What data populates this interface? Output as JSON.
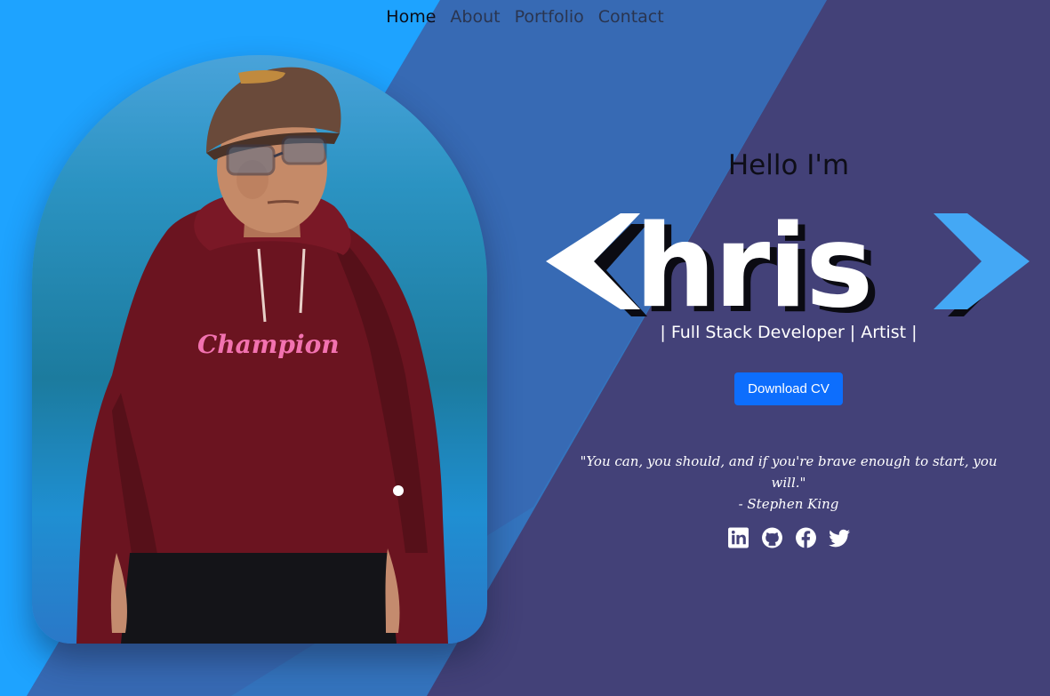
{
  "nav": {
    "items": [
      {
        "label": "Home",
        "active": true
      },
      {
        "label": "About",
        "active": false
      },
      {
        "label": "Portfolio",
        "active": false
      },
      {
        "label": "Contact",
        "active": false
      }
    ]
  },
  "hero": {
    "greeting": "Hello I'm",
    "logo": {
      "open_bracket": "<",
      "name": "hris",
      "close_bracket": ">",
      "colors": {
        "text": "#ffffff",
        "shadow": "#0b0b12",
        "accent_bracket": "#44a8f5"
      }
    },
    "roles": "| Full Stack Developer | Artist |",
    "cv_button": "Download CV",
    "quote": {
      "text": "\"You can, you should, and if you're brave enough to start, you will.\"",
      "author": "- Stephen King"
    },
    "hoodie_brand": "Champion",
    "socials": [
      {
        "icon": "linkedin-icon"
      },
      {
        "icon": "github-icon"
      },
      {
        "icon": "facebook-icon"
      },
      {
        "icon": "twitter-icon"
      }
    ]
  },
  "colors": {
    "sky_blue": "#1ea3ff",
    "mid_blue": "#3474be",
    "navy_purple": "#434178",
    "button_blue": "#0d6efd"
  }
}
